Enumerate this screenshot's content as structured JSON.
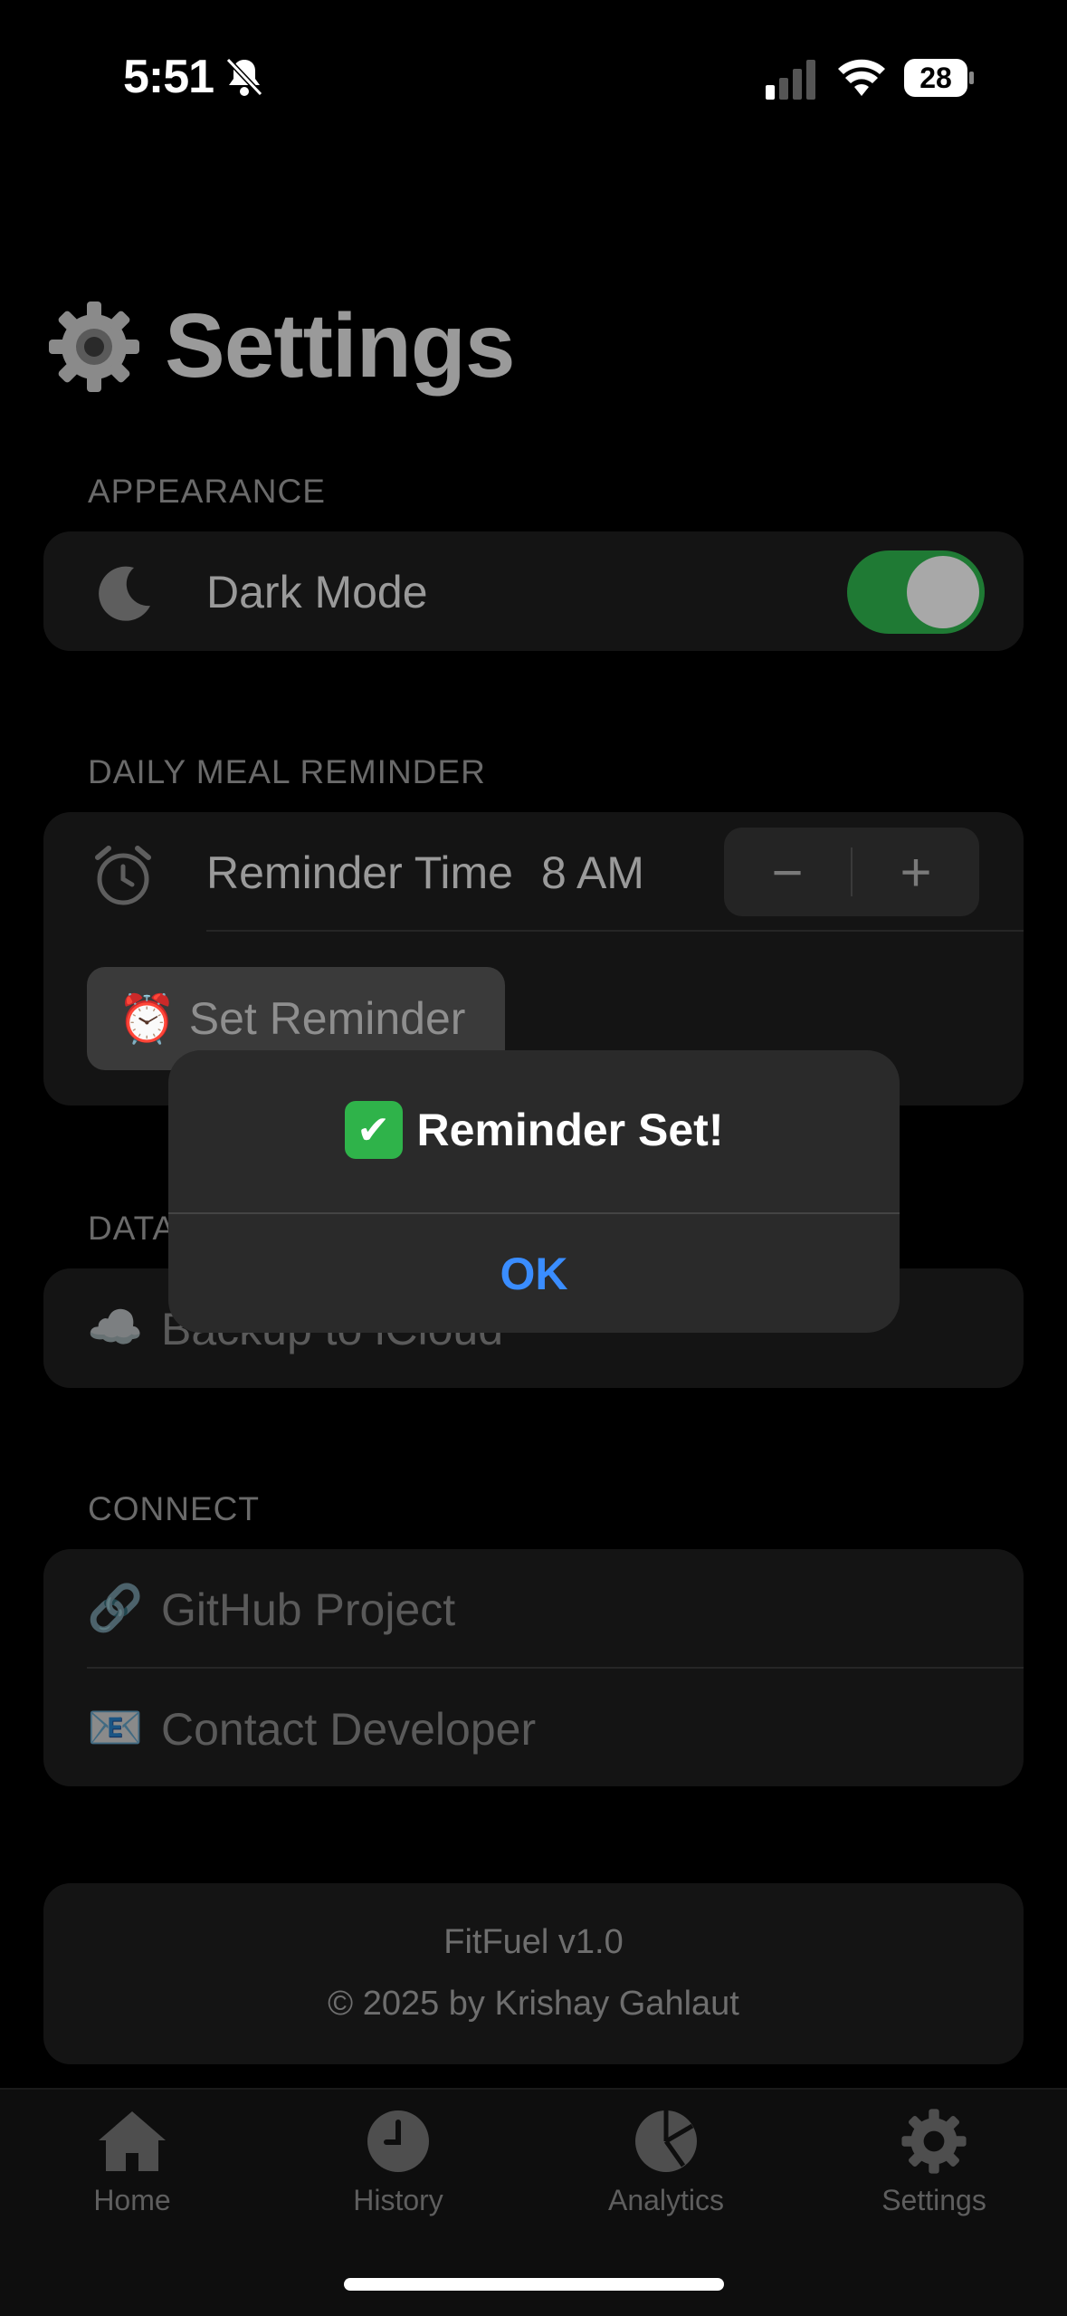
{
  "status_bar": {
    "time": "5:51",
    "battery": "28"
  },
  "page": {
    "title": "Settings",
    "title_icon": "⚙️"
  },
  "appearance": {
    "section_label": "APPEARANCE",
    "dark_mode_label": "Dark Mode",
    "dark_mode_on": true
  },
  "reminder": {
    "section_label": "DAILY MEAL REMINDER",
    "time_label": "Reminder Time",
    "time_value": "8 AM",
    "minus": "−",
    "plus": "+",
    "set_button_icon": "⏰",
    "set_button_label": "Set Reminder"
  },
  "data": {
    "section_label": "DATA",
    "backup_icon": "☁️",
    "backup_label": "Backup to iCloud"
  },
  "connect": {
    "section_label": "CONNECT",
    "github_icon": "🔗",
    "github_label": "GitHub Project",
    "contact_icon": "📧",
    "contact_label": "Contact Developer"
  },
  "footer": {
    "version": "FitFuel v1.0",
    "copyright": "© 2025 by Krishay Gahlaut"
  },
  "tabs": [
    {
      "label": "Home",
      "icon": "house-icon"
    },
    {
      "label": "History",
      "icon": "clock-icon"
    },
    {
      "label": "Analytics",
      "icon": "pie-chart-icon"
    },
    {
      "label": "Settings",
      "icon": "gear-icon"
    }
  ],
  "alert": {
    "check_icon": "✔",
    "message": "Reminder Set!",
    "ok_label": "OK"
  },
  "colors": {
    "accent": "#3a8dff",
    "toggle_on": "#1f7a34",
    "check_green": "#2fb34a"
  }
}
